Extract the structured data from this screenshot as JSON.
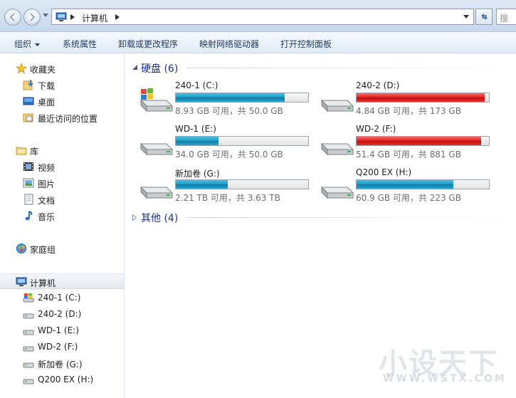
{
  "address": {
    "crumb": "计算机",
    "search_placeholder": "搜"
  },
  "toolbar": {
    "organize": "组织",
    "system_props": "系统属性",
    "uninstall": "卸载或更改程序",
    "map_drive": "映射网络驱动器",
    "control_panel": "打开控制面板"
  },
  "nav": {
    "favorites": "收藏夹",
    "downloads": "下载",
    "desktop": "桌面",
    "recent": "最近访问的位置",
    "libraries": "库",
    "videos": "视频",
    "pictures": "图片",
    "documents": "文档",
    "music": "音乐",
    "homegroup": "家庭组",
    "computer": "计算机",
    "drives": [
      "240-1 (C:)",
      "240-2 (D:)",
      "WD-1 (E:)",
      "WD-2 (F:)",
      "新加卷 (G:)",
      "Q200 EX (H:)"
    ]
  },
  "groups": {
    "hdd": "硬盘 (6)",
    "other": "其他 (4)"
  },
  "drives": [
    {
      "name": "240-1 (C:)",
      "info": "8.93 GB 可用，共 50.0 GB",
      "used_fraction": 0.82,
      "full": false,
      "system": true
    },
    {
      "name": "240-2 (D:)",
      "info": "4.84 GB 可用，共 173 GB",
      "used_fraction": 0.97,
      "full": true,
      "system": false
    },
    {
      "name": "WD-1 (E:)",
      "info": "34.0 GB 可用，共 50.0 GB",
      "used_fraction": 0.32,
      "full": false,
      "system": false
    },
    {
      "name": "WD-2 (F:)",
      "info": "51.4 GB 可用，共 881 GB",
      "used_fraction": 0.94,
      "full": true,
      "system": false
    },
    {
      "name": "新加卷 (G:)",
      "info": "2.21 TB 可用，共 3.63 TB",
      "used_fraction": 0.39,
      "full": false,
      "system": false
    },
    {
      "name": "Q200 EX (H:)",
      "info": "60.9 GB 可用，共 223 GB",
      "used_fraction": 0.73,
      "full": false,
      "system": false
    }
  ],
  "watermark": {
    "line1": "小设天下",
    "line2": "WWW.WSTX.COM"
  },
  "colors": {
    "accent": "#1e3287",
    "bar_normal": "#1f9fc7",
    "bar_full": "#e32222"
  }
}
